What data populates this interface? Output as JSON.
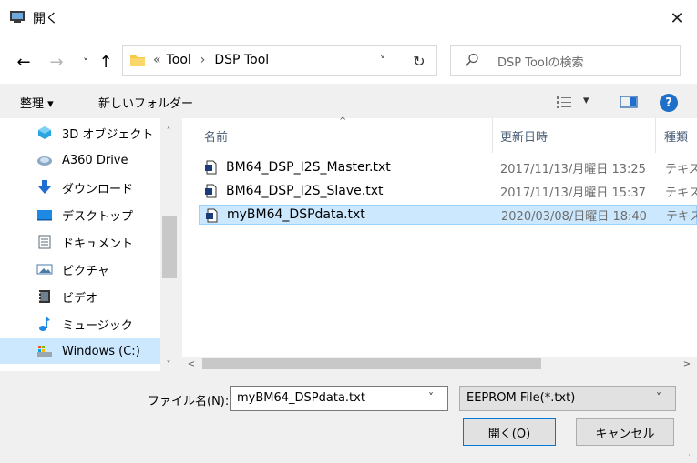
{
  "window": {
    "title": "開く",
    "close_glyph": "✕"
  },
  "nav": {
    "back": "←",
    "forward": "→",
    "recent": "˅",
    "up": "↑",
    "address": {
      "chevron": "«",
      "segments": [
        "Tool",
        "›",
        "DSP Tool"
      ],
      "dropdown": "˅",
      "refresh": "↻"
    },
    "search_placeholder": "DSP Toolの検索"
  },
  "toolbar": {
    "organize": "整理 ▾",
    "new_folder": "新しいフォルダー",
    "view_dropdown": "▾",
    "help": "?"
  },
  "sidebar": {
    "items": [
      {
        "label": "3D オブジェクト",
        "icon": "3d-objects-icon",
        "color": "#2ba4e0"
      },
      {
        "label": "A360 Drive",
        "icon": "cloud-drive-icon",
        "color": "#6a8fb0"
      },
      {
        "label": "ダウンロード",
        "icon": "download-icon",
        "color": "#1e6fd0"
      },
      {
        "label": "デスクトップ",
        "icon": "desktop-icon",
        "color": "#1e88e5"
      },
      {
        "label": "ドキュメント",
        "icon": "document-icon",
        "color": "#5a6b7a"
      },
      {
        "label": "ピクチャ",
        "icon": "pictures-icon",
        "color": "#4a7aa8"
      },
      {
        "label": "ビデオ",
        "icon": "video-icon",
        "color": "#333333"
      },
      {
        "label": "ミュージック",
        "icon": "music-icon",
        "color": "#1e88e5"
      },
      {
        "label": "Windows (C:)",
        "icon": "drive-icon",
        "color": "#2aa0d0"
      }
    ]
  },
  "filelist": {
    "columns": {
      "name": "名前",
      "date": "更新日時",
      "type": "種類",
      "sort_glyph": "^"
    },
    "files": [
      {
        "name": "BM64_DSP_I2S_Master.txt",
        "date": "2017/11/13/月曜日 13:25",
        "type": "テキス"
      },
      {
        "name": "BM64_DSP_I2S_Slave.txt",
        "date": "2017/11/13/月曜日 15:37",
        "type": "テキス"
      },
      {
        "name": "myBM64_DSPdata.txt",
        "date": "2020/03/08/日曜日 18:40",
        "type": "テキス"
      }
    ]
  },
  "scroll": {
    "up": "˄",
    "down": "˅",
    "left": "<",
    "right": ">"
  },
  "bottom": {
    "filename_label": "ファイル名(N):",
    "filename_value": "myBM64_DSPdata.txt",
    "filename_drop": "˅",
    "filetype_value": "EEPROM File(*.txt)",
    "filetype_drop": "˅",
    "open_button": "開く(O)",
    "cancel_button": "キャンセル"
  },
  "colors": {
    "accent": "#0078d7",
    "selection": "#cce8ff",
    "selection_border": "#99d1ff",
    "help": "#1f6fc8"
  }
}
